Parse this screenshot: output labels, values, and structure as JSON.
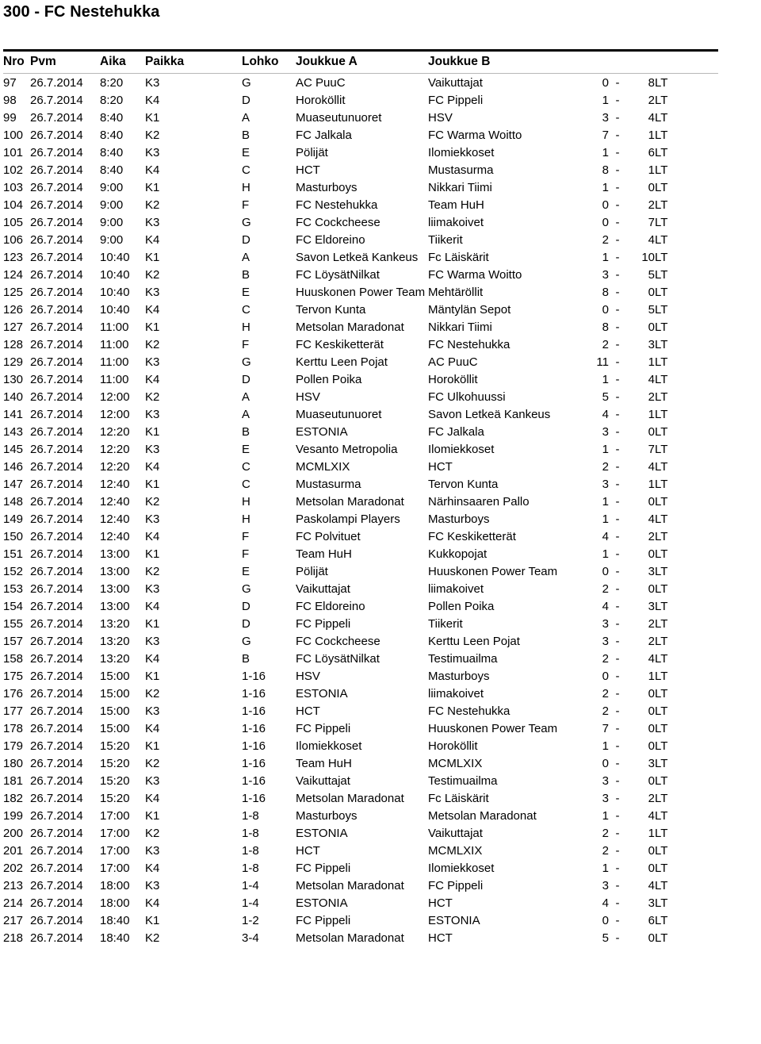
{
  "title": "300 - FC Nestehukka",
  "table": {
    "columns": [
      {
        "key": "nro",
        "label": "Nro"
      },
      {
        "key": "pvm",
        "label": "Pvm"
      },
      {
        "key": "aika",
        "label": "Aika"
      },
      {
        "key": "paikka",
        "label": "Paikka"
      },
      {
        "key": "lohko",
        "label": "Lohko"
      },
      {
        "key": "team_a",
        "label": "Joukkue A"
      },
      {
        "key": "team_b",
        "label": "Joukkue B"
      },
      {
        "key": "goals_a",
        "label": ""
      },
      {
        "key": "dash",
        "label": ""
      },
      {
        "key": "goals_b",
        "label": ""
      },
      {
        "key": "status",
        "label": ""
      }
    ],
    "dash": "-",
    "rows": [
      {
        "nro": "97",
        "pvm": "26.7.2014",
        "aika": "8:20",
        "paikka": "K3",
        "lohko": "G",
        "team_a": "AC PuuC",
        "team_b": "Vaikuttajat",
        "goals_a": "0",
        "goals_b": "8",
        "status": "LT"
      },
      {
        "nro": "98",
        "pvm": "26.7.2014",
        "aika": "8:20",
        "paikka": "K4",
        "lohko": "D",
        "team_a": "Horoköllit",
        "team_b": "FC Pippeli",
        "goals_a": "1",
        "goals_b": "2",
        "status": "LT"
      },
      {
        "nro": "99",
        "pvm": "26.7.2014",
        "aika": "8:40",
        "paikka": "K1",
        "lohko": "A",
        "team_a": "Muaseutunuoret",
        "team_b": "HSV",
        "goals_a": "3",
        "goals_b": "4",
        "status": "LT"
      },
      {
        "nro": "100",
        "pvm": "26.7.2014",
        "aika": "8:40",
        "paikka": "K2",
        "lohko": "B",
        "team_a": "FC Jalkala",
        "team_b": "FC Warma Woitto",
        "goals_a": "7",
        "goals_b": "1",
        "status": "LT"
      },
      {
        "nro": "101",
        "pvm": "26.7.2014",
        "aika": "8:40",
        "paikka": "K3",
        "lohko": "E",
        "team_a": "Pölijät",
        "team_b": "Ilomiekkoset",
        "goals_a": "1",
        "goals_b": "6",
        "status": "LT"
      },
      {
        "nro": "102",
        "pvm": "26.7.2014",
        "aika": "8:40",
        "paikka": "K4",
        "lohko": "C",
        "team_a": "HCT",
        "team_b": "Mustasurma",
        "goals_a": "8",
        "goals_b": "1",
        "status": "LT"
      },
      {
        "nro": "103",
        "pvm": "26.7.2014",
        "aika": "9:00",
        "paikka": "K1",
        "lohko": "H",
        "team_a": "Masturboys",
        "team_b": "Nikkari Tiimi",
        "goals_a": "1",
        "goals_b": "0",
        "status": "LT"
      },
      {
        "nro": "104",
        "pvm": "26.7.2014",
        "aika": "9:00",
        "paikka": "K2",
        "lohko": "F",
        "team_a": "FC Nestehukka",
        "team_b": "Team HuH",
        "goals_a": "0",
        "goals_b": "2",
        "status": "LT"
      },
      {
        "nro": "105",
        "pvm": "26.7.2014",
        "aika": "9:00",
        "paikka": "K3",
        "lohko": "G",
        "team_a": "FC Cockcheese",
        "team_b": "liimakoivet",
        "goals_a": "0",
        "goals_b": "7",
        "status": "LT"
      },
      {
        "nro": "106",
        "pvm": "26.7.2014",
        "aika": "9:00",
        "paikka": "K4",
        "lohko": "D",
        "team_a": "FC Eldoreino",
        "team_b": "Tiikerit",
        "goals_a": "2",
        "goals_b": "4",
        "status": "LT"
      },
      {
        "nro": "123",
        "pvm": "26.7.2014",
        "aika": "10:40",
        "paikka": "K1",
        "lohko": "A",
        "team_a": "Savon Letkeä Kankeus",
        "team_b": "Fc Läiskärit",
        "goals_a": "1",
        "goals_b": "10",
        "status": "LT"
      },
      {
        "nro": "124",
        "pvm": "26.7.2014",
        "aika": "10:40",
        "paikka": "K2",
        "lohko": "B",
        "team_a": "FC LöysätNilkat",
        "team_b": "FC Warma Woitto",
        "goals_a": "3",
        "goals_b": "5",
        "status": "LT"
      },
      {
        "nro": "125",
        "pvm": "26.7.2014",
        "aika": "10:40",
        "paikka": "K3",
        "lohko": "E",
        "team_a": "Huuskonen Power Team",
        "team_b": "Mehtäröllit",
        "goals_a": "8",
        "goals_b": "0",
        "status": "LT"
      },
      {
        "nro": "126",
        "pvm": "26.7.2014",
        "aika": "10:40",
        "paikka": "K4",
        "lohko": "C",
        "team_a": "Tervon Kunta",
        "team_b": "Mäntylän Sepot",
        "goals_a": "0",
        "goals_b": "5",
        "status": "LT"
      },
      {
        "nro": "127",
        "pvm": "26.7.2014",
        "aika": "11:00",
        "paikka": "K1",
        "lohko": "H",
        "team_a": "Metsolan Maradonat",
        "team_b": "Nikkari Tiimi",
        "goals_a": "8",
        "goals_b": "0",
        "status": "LT"
      },
      {
        "nro": "128",
        "pvm": "26.7.2014",
        "aika": "11:00",
        "paikka": "K2",
        "lohko": "F",
        "team_a": "FC Keskiketterät",
        "team_b": "FC Nestehukka",
        "goals_a": "2",
        "goals_b": "3",
        "status": "LT"
      },
      {
        "nro": "129",
        "pvm": "26.7.2014",
        "aika": "11:00",
        "paikka": "K3",
        "lohko": "G",
        "team_a": "Kerttu Leen Pojat",
        "team_b": "AC PuuC",
        "goals_a": "11",
        "goals_b": "1",
        "status": "LT"
      },
      {
        "nro": "130",
        "pvm": "26.7.2014",
        "aika": "11:00",
        "paikka": "K4",
        "lohko": "D",
        "team_a": "Pollen Poika",
        "team_b": "Horoköllit",
        "goals_a": "1",
        "goals_b": "4",
        "status": "LT"
      },
      {
        "nro": "140",
        "pvm": "26.7.2014",
        "aika": "12:00",
        "paikka": "K2",
        "lohko": "A",
        "team_a": "HSV",
        "team_b": "FC Ulkohuussi",
        "goals_a": "5",
        "goals_b": "2",
        "status": "LT"
      },
      {
        "nro": "141",
        "pvm": "26.7.2014",
        "aika": "12:00",
        "paikka": "K3",
        "lohko": "A",
        "team_a": "Muaseutunuoret",
        "team_b": "Savon Letkeä Kankeus",
        "goals_a": "4",
        "goals_b": "1",
        "status": "LT"
      },
      {
        "nro": "143",
        "pvm": "26.7.2014",
        "aika": "12:20",
        "paikka": "K1",
        "lohko": "B",
        "team_a": "ESTONIA",
        "team_b": "FC Jalkala",
        "goals_a": "3",
        "goals_b": "0",
        "status": "LT"
      },
      {
        "nro": "145",
        "pvm": "26.7.2014",
        "aika": "12:20",
        "paikka": "K3",
        "lohko": "E",
        "team_a": "Vesanto Metropolia",
        "team_b": "Ilomiekkoset",
        "goals_a": "1",
        "goals_b": "7",
        "status": "LT"
      },
      {
        "nro": "146",
        "pvm": "26.7.2014",
        "aika": "12:20",
        "paikka": "K4",
        "lohko": "C",
        "team_a": "MCMLXIX",
        "team_b": "HCT",
        "goals_a": "2",
        "goals_b": "4",
        "status": "LT"
      },
      {
        "nro": "147",
        "pvm": "26.7.2014",
        "aika": "12:40",
        "paikka": "K1",
        "lohko": "C",
        "team_a": "Mustasurma",
        "team_b": "Tervon Kunta",
        "goals_a": "3",
        "goals_b": "1",
        "status": "LT"
      },
      {
        "nro": "148",
        "pvm": "26.7.2014",
        "aika": "12:40",
        "paikka": "K2",
        "lohko": "H",
        "team_a": "Metsolan Maradonat",
        "team_b": "Närhinsaaren Pallo",
        "goals_a": "1",
        "goals_b": "0",
        "status": "LT"
      },
      {
        "nro": "149",
        "pvm": "26.7.2014",
        "aika": "12:40",
        "paikka": "K3",
        "lohko": "H",
        "team_a": "Paskolampi Players",
        "team_b": "Masturboys",
        "goals_a": "1",
        "goals_b": "4",
        "status": "LT"
      },
      {
        "nro": "150",
        "pvm": "26.7.2014",
        "aika": "12:40",
        "paikka": "K4",
        "lohko": "F",
        "team_a": "FC Polvituet",
        "team_b": "FC Keskiketterät",
        "goals_a": "4",
        "goals_b": "2",
        "status": "LT"
      },
      {
        "nro": "151",
        "pvm": "26.7.2014",
        "aika": "13:00",
        "paikka": "K1",
        "lohko": "F",
        "team_a": "Team HuH",
        "team_b": "Kukkopojat",
        "goals_a": "1",
        "goals_b": "0",
        "status": "LT"
      },
      {
        "nro": "152",
        "pvm": "26.7.2014",
        "aika": "13:00",
        "paikka": "K2",
        "lohko": "E",
        "team_a": "Pölijät",
        "team_b": "Huuskonen Power Team",
        "goals_a": "0",
        "goals_b": "3",
        "status": "LT"
      },
      {
        "nro": "153",
        "pvm": "26.7.2014",
        "aika": "13:00",
        "paikka": "K3",
        "lohko": "G",
        "team_a": "Vaikuttajat",
        "team_b": "liimakoivet",
        "goals_a": "2",
        "goals_b": "0",
        "status": "LT"
      },
      {
        "nro": "154",
        "pvm": "26.7.2014",
        "aika": "13:00",
        "paikka": "K4",
        "lohko": "D",
        "team_a": "FC Eldoreino",
        "team_b": "Pollen Poika",
        "goals_a": "4",
        "goals_b": "3",
        "status": "LT"
      },
      {
        "nro": "155",
        "pvm": "26.7.2014",
        "aika": "13:20",
        "paikka": "K1",
        "lohko": "D",
        "team_a": "FC Pippeli",
        "team_b": "Tiikerit",
        "goals_a": "3",
        "goals_b": "2",
        "status": "LT"
      },
      {
        "nro": "157",
        "pvm": "26.7.2014",
        "aika": "13:20",
        "paikka": "K3",
        "lohko": "G",
        "team_a": "FC Cockcheese",
        "team_b": "Kerttu Leen Pojat",
        "goals_a": "3",
        "goals_b": "2",
        "status": "LT"
      },
      {
        "nro": "158",
        "pvm": "26.7.2014",
        "aika": "13:20",
        "paikka": "K4",
        "lohko": "B",
        "team_a": "FC LöysätNilkat",
        "team_b": "Testimuailma",
        "goals_a": "2",
        "goals_b": "4",
        "status": "LT"
      },
      {
        "nro": "175",
        "pvm": "26.7.2014",
        "aika": "15:00",
        "paikka": "K1",
        "lohko": "1-16",
        "team_a": "HSV",
        "team_b": "Masturboys",
        "goals_a": "0",
        "goals_b": "1",
        "status": "LT"
      },
      {
        "nro": "176",
        "pvm": "26.7.2014",
        "aika": "15:00",
        "paikka": "K2",
        "lohko": "1-16",
        "team_a": "ESTONIA",
        "team_b": "liimakoivet",
        "goals_a": "2",
        "goals_b": "0",
        "status": "LT"
      },
      {
        "nro": "177",
        "pvm": "26.7.2014",
        "aika": "15:00",
        "paikka": "K3",
        "lohko": "1-16",
        "team_a": "HCT",
        "team_b": "FC Nestehukka",
        "goals_a": "2",
        "goals_b": "0",
        "status": "LT"
      },
      {
        "nro": "178",
        "pvm": "26.7.2014",
        "aika": "15:00",
        "paikka": "K4",
        "lohko": "1-16",
        "team_a": "FC Pippeli",
        "team_b": "Huuskonen Power Team",
        "goals_a": "7",
        "goals_b": "0",
        "status": "LT"
      },
      {
        "nro": "179",
        "pvm": "26.7.2014",
        "aika": "15:20",
        "paikka": "K1",
        "lohko": "1-16",
        "team_a": "Ilomiekkoset",
        "team_b": "Horoköllit",
        "goals_a": "1",
        "goals_b": "0",
        "status": "LT"
      },
      {
        "nro": "180",
        "pvm": "26.7.2014",
        "aika": "15:20",
        "paikka": "K2",
        "lohko": "1-16",
        "team_a": "Team HuH",
        "team_b": "MCMLXIX",
        "goals_a": "0",
        "goals_b": "3",
        "status": "LT"
      },
      {
        "nro": "181",
        "pvm": "26.7.2014",
        "aika": "15:20",
        "paikka": "K3",
        "lohko": "1-16",
        "team_a": "Vaikuttajat",
        "team_b": "Testimuailma",
        "goals_a": "3",
        "goals_b": "0",
        "status": "LT"
      },
      {
        "nro": "182",
        "pvm": "26.7.2014",
        "aika": "15:20",
        "paikka": "K4",
        "lohko": "1-16",
        "team_a": "Metsolan Maradonat",
        "team_b": "Fc Läiskärit",
        "goals_a": "3",
        "goals_b": "2",
        "status": "LT"
      },
      {
        "nro": "199",
        "pvm": "26.7.2014",
        "aika": "17:00",
        "paikka": "K1",
        "lohko": "1-8",
        "team_a": "Masturboys",
        "team_b": "Metsolan Maradonat",
        "goals_a": "1",
        "goals_b": "4",
        "status": "LT"
      },
      {
        "nro": "200",
        "pvm": "26.7.2014",
        "aika": "17:00",
        "paikka": "K2",
        "lohko": "1-8",
        "team_a": "ESTONIA",
        "team_b": "Vaikuttajat",
        "goals_a": "2",
        "goals_b": "1",
        "status": "LT"
      },
      {
        "nro": "201",
        "pvm": "26.7.2014",
        "aika": "17:00",
        "paikka": "K3",
        "lohko": "1-8",
        "team_a": "HCT",
        "team_b": "MCMLXIX",
        "goals_a": "2",
        "goals_b": "0",
        "status": "LT"
      },
      {
        "nro": "202",
        "pvm": "26.7.2014",
        "aika": "17:00",
        "paikka": "K4",
        "lohko": "1-8",
        "team_a": "FC Pippeli",
        "team_b": "Ilomiekkoset",
        "goals_a": "1",
        "goals_b": "0",
        "status": "LT"
      },
      {
        "nro": "213",
        "pvm": "26.7.2014",
        "aika": "18:00",
        "paikka": "K3",
        "lohko": "1-4",
        "team_a": "Metsolan Maradonat",
        "team_b": "FC Pippeli",
        "goals_a": "3",
        "goals_b": "4",
        "status": "LT"
      },
      {
        "nro": "214",
        "pvm": "26.7.2014",
        "aika": "18:00",
        "paikka": "K4",
        "lohko": "1-4",
        "team_a": "ESTONIA",
        "team_b": "HCT",
        "goals_a": "4",
        "goals_b": "3",
        "status": "LT"
      },
      {
        "nro": "217",
        "pvm": "26.7.2014",
        "aika": "18:40",
        "paikka": "K1",
        "lohko": "1-2",
        "team_a": "FC Pippeli",
        "team_b": "ESTONIA",
        "goals_a": "0",
        "goals_b": "6",
        "status": "LT"
      },
      {
        "nro": "218",
        "pvm": "26.7.2014",
        "aika": "18:40",
        "paikka": "K2",
        "lohko": "3-4",
        "team_a": "Metsolan Maradonat",
        "team_b": "HCT",
        "goals_a": "5",
        "goals_b": "0",
        "status": "LT"
      }
    ]
  }
}
